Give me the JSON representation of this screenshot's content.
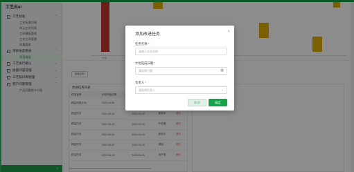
{
  "app": {
    "title": "工艺云ai"
  },
  "colors": {
    "brand": "#16a34a",
    "bar_red": "#c0392b",
    "bar_yellow": "#e0b000",
    "danger": "#e04848"
  },
  "sidebar": {
    "groups": [
      {
        "label": "工艺标准",
        "icon": "settings-icon",
        "items": [
          "工艺标准列表",
          "待认工艺列表",
          "工序模板管理",
          "工艺工序管理",
          "质量要求"
        ]
      },
      {
        "label": "项目进度看板",
        "icon": "dashboard-icon",
        "items": [
          "项目看板"
        ]
      },
      {
        "label": "工艺执行确认",
        "icon": "check-icon",
        "items": []
      },
      {
        "label": "质量问题管理",
        "icon": "quality-icon",
        "items": []
      },
      {
        "label": "工艺知识库管理",
        "icon": "book-icon",
        "items": []
      },
      {
        "label": "客户问题管理",
        "icon": "customer-icon",
        "items": [
          "产品问题统计分析"
        ]
      }
    ]
  },
  "main": {
    "chart_tick": "任务",
    "sub_button": "指标分析",
    "task_panel_title": "改进任务列表",
    "table": {
      "headers": [
        "任务名称",
        "计划开始日期",
        "计划完成",
        "负责人",
        "状态"
      ],
      "rows": [
        [
          "精益改善计划",
          "2022-04-06",
          "2022-05",
          "",
          "进行"
        ],
        [
          "精益任务",
          "2022-05-15",
          "2022-06-15",
          "廖振宇",
          "进行"
        ],
        [
          "精益任务",
          "2022-05-15",
          "2022-05-15",
          "叶佳璐",
          "进行"
        ],
        [
          "精益任务",
          "2022-05-15",
          "2022-05-15",
          "廖振宇",
          "进行"
        ],
        [
          "精益任务",
          "2022-05-15",
          "2022-05-15",
          "周晓",
          "进行"
        ],
        [
          "精益任务",
          "2022-05-15",
          "2022-05-15",
          "张子琪",
          "进行"
        ]
      ]
    }
  },
  "modal": {
    "title": "添加改进任务",
    "task_name_label": "任务名称",
    "task_name_placeholder": "请输入任务名称",
    "deadline_label": "计划完成日期",
    "deadline_placeholder": "请选择日期",
    "owner_label": "负责人",
    "owner_placeholder": "请选择负责人",
    "cancel_label": "取消",
    "confirm_label": "确定",
    "required_mark": "*"
  }
}
